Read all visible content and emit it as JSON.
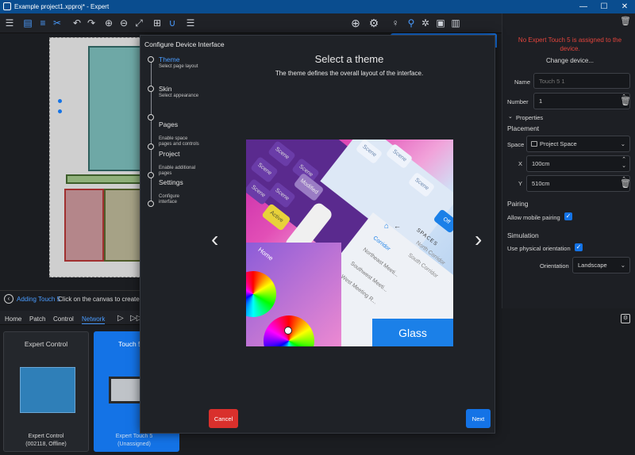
{
  "app": {
    "window_title": "Example project1.xpproj* - Expert"
  },
  "window_controls": {
    "minimize": "—",
    "maximize": "☐",
    "close": "✕"
  },
  "toolbar": {
    "left_icons": [
      "menu-icon",
      "document-icon",
      "list-icon",
      "scissors-icon",
      "undo-icon",
      "redo-icon",
      "zoom-in-icon",
      "zoom-out-icon",
      "fit-icon",
      "grid-icon",
      "magnet-icon",
      "align-icon"
    ],
    "right_icons": [
      "add-icon",
      "settings-icon",
      "lightbulb-icon",
      "network-icon",
      "gear-icon",
      "image-icon",
      "layout-icon",
      "edit-icon",
      "play-icon",
      "save-icon",
      "settings-icon"
    ]
  },
  "dialog": {
    "title": "Configure Device Interface",
    "heading": "Select a theme",
    "subheading": "The theme defines the overall layout of the interface.",
    "steps": [
      {
        "title": "Theme",
        "sub": "Select page layout",
        "active": true
      },
      {
        "title": "Skin",
        "sub": "Select appearance",
        "active": false
      },
      {
        "title": "Pages",
        "sub": "Enable space\npages and controls",
        "active": false
      },
      {
        "title": "Project",
        "sub": "Enable additional\npages",
        "active": false
      },
      {
        "title": "Settings",
        "sub": "Configure\ninterface",
        "active": false
      },
      {
        "title": "",
        "sub": "",
        "active": false
      }
    ],
    "preview": {
      "scene_labels": [
        "Scene",
        "Scene",
        "Scene",
        "Scene",
        "Scene",
        "Scene",
        "Scene",
        "Modified",
        "Scene",
        "Active",
        "Off"
      ],
      "home_label": "Home",
      "spaces_label": "SPACES",
      "rooms": [
        "Corridor",
        "Northeast Meeti...",
        "Southwest Meeti...",
        "West Meeting R...",
        "North Corridor",
        "South Corridor"
      ],
      "theme_name": "Glass"
    },
    "prev_arrow": "‹",
    "next_arrow": "›",
    "cancel_label": "Cancel",
    "next_label": "Next"
  },
  "right_panel": {
    "warning": "No Expert Touch 5 is assigned to the device.",
    "change_device": "Change device...",
    "name_label": "Name",
    "name_placeholder": "Touch 5 1",
    "number_label": "Number",
    "number_value": "1",
    "properties_label": "Properties",
    "placement_label": "Placement",
    "space_label": "Space",
    "space_value": "Project Space",
    "x_label": "X",
    "x_value": "100cm",
    "y_label": "Y",
    "y_value": "510cm",
    "pairing_label": "Pairing",
    "allow_mobile_pairing": "Allow mobile pairing",
    "allow_mobile_pairing_checked": true,
    "simulation_label": "Simulation",
    "use_physical_orientation": "Use physical orientation",
    "use_physical_orientation_checked": true,
    "orientation_label": "Orientation",
    "orientation_value": "Landscape"
  },
  "status": {
    "adding_link": "Adding Touch 5",
    "hint": "Click on the canvas to create a d"
  },
  "bottom_tabs": [
    "Home",
    "Patch",
    "Control",
    "Network"
  ],
  "active_bottom_tab": "Network",
  "devices": [
    {
      "title": "Expert Control",
      "name": "Expert Control",
      "sub": "(002118, Offline)"
    },
    {
      "title": "Touch 5",
      "name": "Expert Touch 5",
      "sub": "(Unassigned)"
    }
  ],
  "colors": {
    "accent": "#1473e6",
    "titlebar": "#0a4d8f",
    "cancel": "#d9302c",
    "warning": "#e2443c",
    "glass_tile": "#1b80e8"
  }
}
